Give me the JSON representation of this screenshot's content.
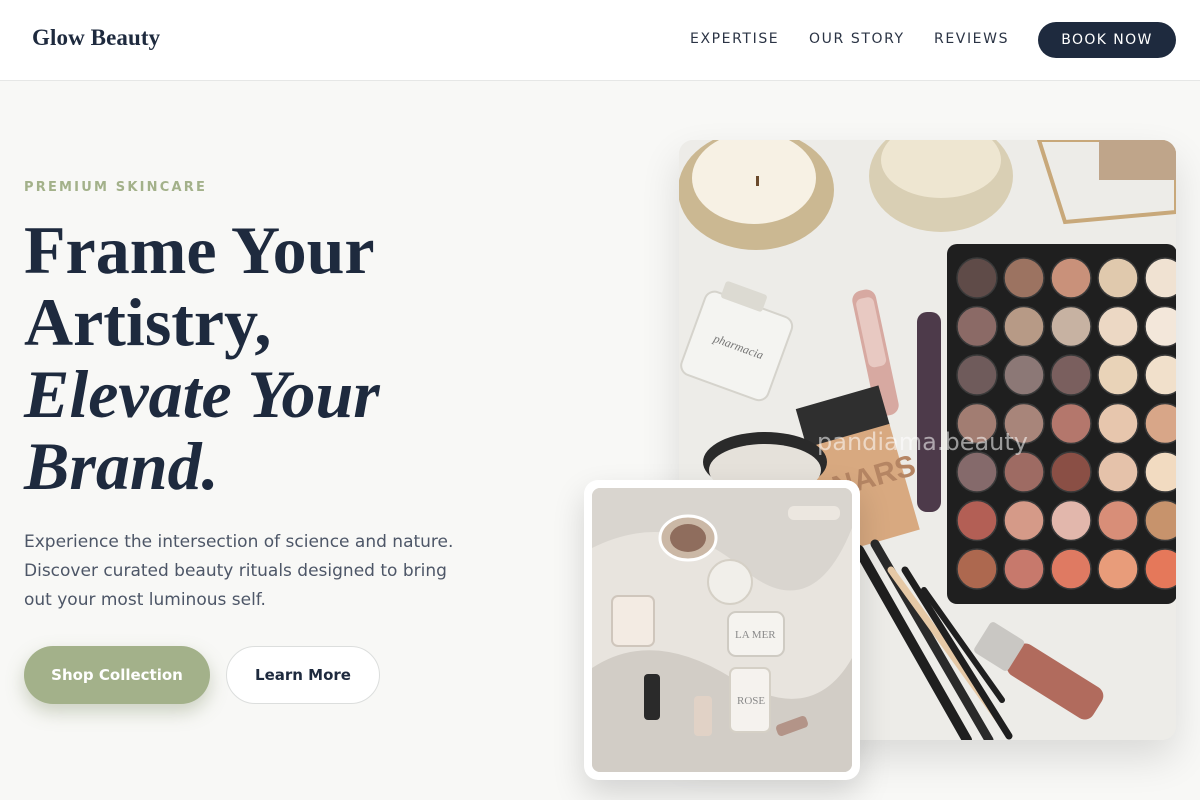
{
  "brand": {
    "name": "Glow Beauty"
  },
  "nav": {
    "links": [
      "EXPERTISE",
      "OUR STORY",
      "REVIEWS"
    ],
    "cta": "BOOK NOW"
  },
  "hero": {
    "eyebrow": "PREMIUM SKINCARE",
    "headline_lines": [
      "Frame Your",
      "Artistry,"
    ],
    "headline_italic_lines": [
      "Elevate Your",
      "Brand."
    ],
    "body_lines": [
      "Experience the intersection of science and nature.",
      "Discover curated beauty rituals designed to bring",
      "out your most luminous self."
    ],
    "primary_cta": "Shop Collection",
    "secondary_cta": "Learn More"
  },
  "images": {
    "hero_watermark": "pandiama.beauty",
    "product_labels": [
      "NARS",
      "ROSE",
      "LA MER"
    ]
  },
  "colors": {
    "navy": "#1e2a3e",
    "sage": "#a3b18a",
    "background": "#f8f8f6"
  }
}
